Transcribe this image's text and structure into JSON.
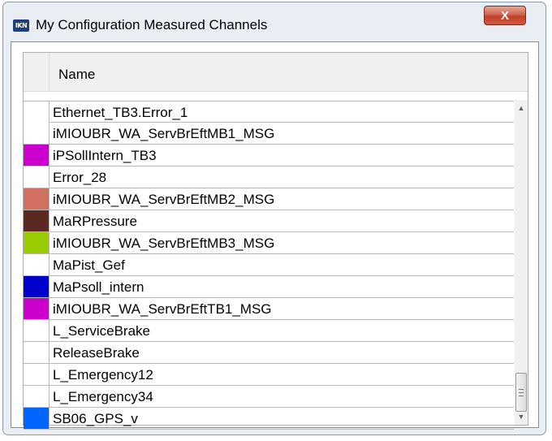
{
  "window": {
    "title": "My Configuration Measured Channels",
    "app_icon_text": "IKN",
    "close_label": "X"
  },
  "table": {
    "column_header": "Name",
    "rows": [
      {
        "name": "Ethernet_TB3.Error_1",
        "color": "#ffffff"
      },
      {
        "name": "iMIOUBR_WA_ServBrEftMB1_MSG",
        "color": "#ffffff"
      },
      {
        "name": "iPSollIntern_TB3",
        "color": "#cc00cc"
      },
      {
        "name": "Error_28",
        "color": "#ffffff"
      },
      {
        "name": "iMIOUBR_WA_ServBrEftMB2_MSG",
        "color": "#d07060"
      },
      {
        "name": "MaRPressure",
        "color": "#5a2a22"
      },
      {
        "name": "iMIOUBR_WA_ServBrEftMB3_MSG",
        "color": "#99cc00"
      },
      {
        "name": "MaPist_Gef",
        "color": "#ffffff"
      },
      {
        "name": "MaPsoll_intern",
        "color": "#0000cc"
      },
      {
        "name": "iMIOUBR_WA_ServBrEftTB1_MSG",
        "color": "#cc00cc"
      },
      {
        "name": "L_ServiceBrake",
        "color": "#ffffff"
      },
      {
        "name": "ReleaseBrake",
        "color": "#ffffff"
      },
      {
        "name": "L_Emergency12",
        "color": "#ffffff"
      },
      {
        "name": "L_Emergency34",
        "color": "#ffffff"
      },
      {
        "name": "SB06_GPS_v",
        "color": "#0066ff"
      }
    ]
  },
  "scrollbar": {
    "up_icon": "scroll-up-arrow",
    "down_icon": "scroll-down-arrow",
    "position_fraction": 0.88
  }
}
